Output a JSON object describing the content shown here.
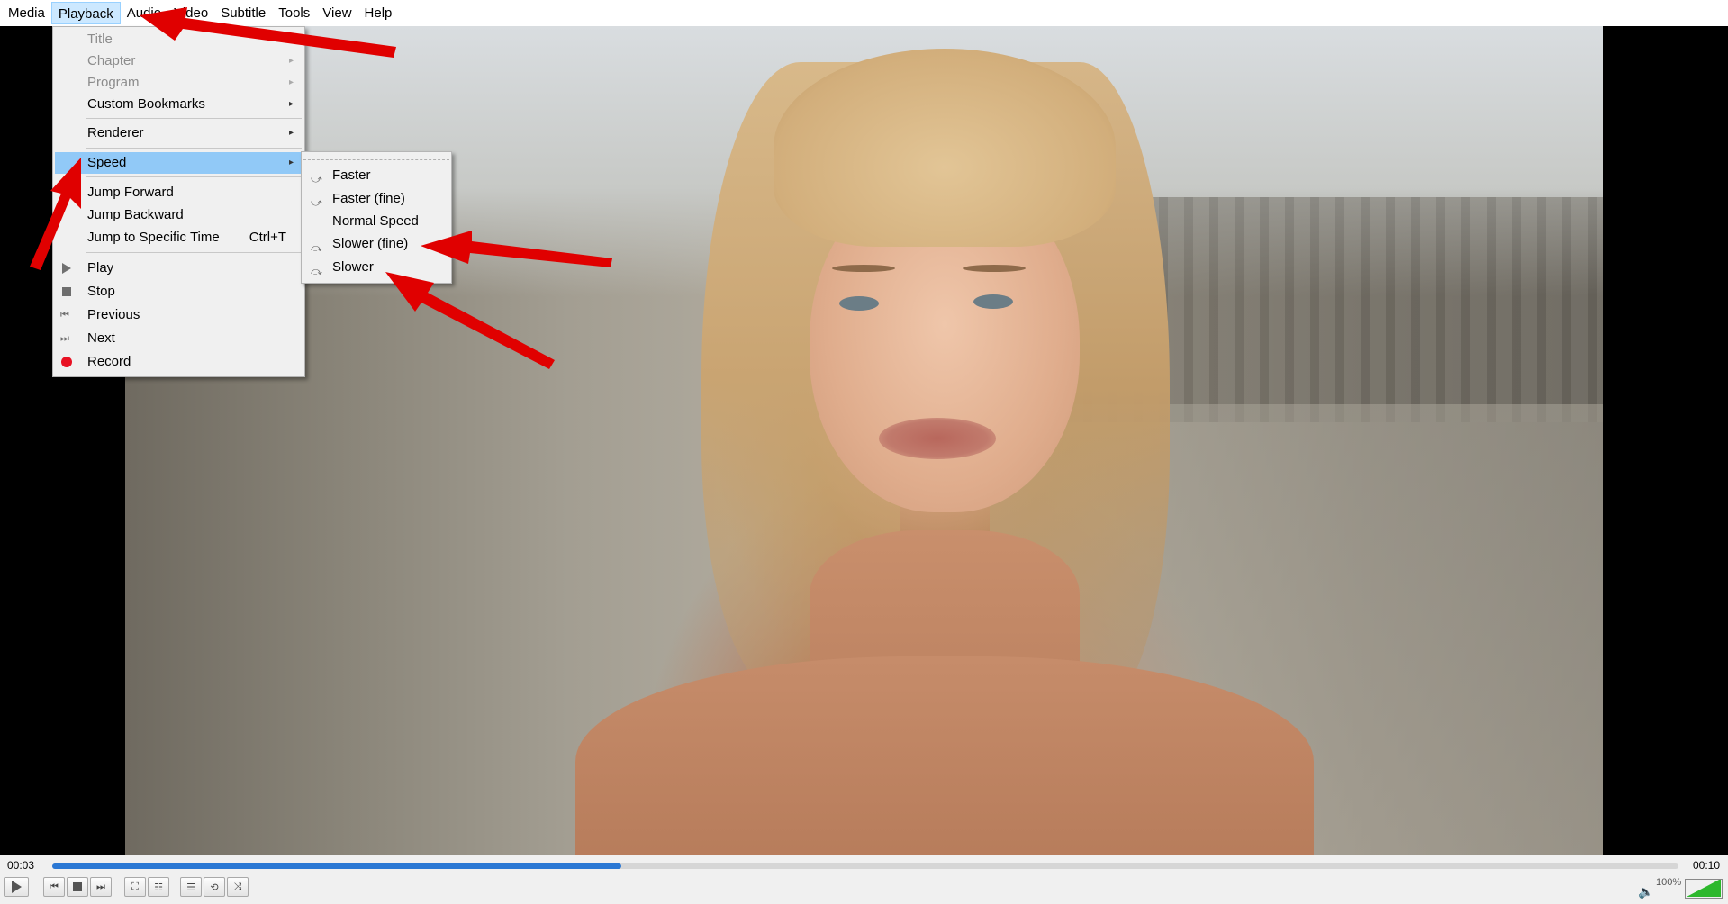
{
  "menubar": {
    "items": [
      "Media",
      "Playback",
      "Audio",
      "Video",
      "Subtitle",
      "Tools",
      "View",
      "Help"
    ]
  },
  "playback_menu": {
    "items": [
      {
        "label": "Title",
        "disabled": true
      },
      {
        "label": "Chapter",
        "disabled": true
      },
      {
        "label": "Program",
        "disabled": true
      },
      {
        "label": "Custom Bookmarks"
      },
      {
        "label": "Renderer"
      },
      {
        "label": "Speed"
      },
      {
        "label": "Jump Forward"
      },
      {
        "label": "Jump Backward"
      },
      {
        "label": "Jump to Specific Time",
        "shortcut": "Ctrl+T"
      },
      {
        "label": "Play"
      },
      {
        "label": "Stop"
      },
      {
        "label": "Previous"
      },
      {
        "label": "Next"
      },
      {
        "label": "Record"
      }
    ]
  },
  "speed_submenu": {
    "items": [
      "Faster",
      "Faster (fine)",
      "Normal Speed",
      "Slower (fine)",
      "Slower"
    ]
  },
  "controls": {
    "elapsed": "00:03",
    "total": "00:10",
    "progress": 0.35,
    "volume": "100%"
  },
  "colors": {
    "highlight": "#91c9f7",
    "accent": "#2b78d4",
    "annotation": "#e00000",
    "record": "#e81123"
  }
}
